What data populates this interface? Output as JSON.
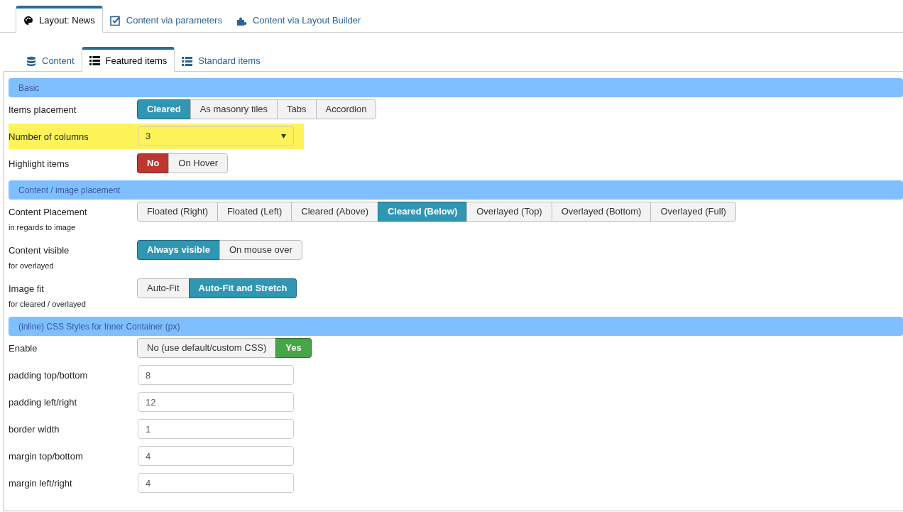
{
  "top_tabs": [
    {
      "label": "Layout: News",
      "selected": true
    },
    {
      "label": "Content via parameters",
      "selected": false
    },
    {
      "label": "Content via Layout Builder",
      "selected": false
    }
  ],
  "sub_tabs": [
    {
      "label": "Content",
      "selected": false
    },
    {
      "label": "Featured items",
      "selected": true
    },
    {
      "label": "Standard items",
      "selected": false
    }
  ],
  "sections": [
    {
      "title": "Basic",
      "rows": [
        {
          "kind": "buttons",
          "label": "Items placement",
          "highlighted": false,
          "color": "#2f96b4",
          "options": [
            {
              "label": "Cleared",
              "selected": true
            },
            {
              "label": "As masonry tiles",
              "selected": false
            },
            {
              "label": "Tabs",
              "selected": false
            },
            {
              "label": "Accordion",
              "selected": false
            }
          ]
        },
        {
          "kind": "select",
          "label": "Number of columns",
          "highlighted": true,
          "value": "3"
        },
        {
          "kind": "buttons",
          "label": "Highlight items",
          "highlighted": false,
          "color": "#bd362f",
          "options": [
            {
              "label": "No",
              "selected": true
            },
            {
              "label": "On Hover",
              "selected": false
            }
          ]
        }
      ]
    },
    {
      "title": "Content / image placement",
      "rows": [
        {
          "kind": "buttons",
          "label": "Content Placement",
          "hint": "in regards to image",
          "highlighted": false,
          "color": "#2f96b4",
          "options": [
            {
              "label": "Floated (Right)",
              "selected": false
            },
            {
              "label": "Floated (Left)",
              "selected": false
            },
            {
              "label": "Cleared (Above)",
              "selected": false
            },
            {
              "label": "Cleared (Below)",
              "selected": true
            },
            {
              "label": "Overlayed (Top)",
              "selected": false
            },
            {
              "label": "Overlayed (Bottom)",
              "selected": false
            },
            {
              "label": "Overlayed (Full)",
              "selected": false
            }
          ]
        },
        {
          "kind": "buttons",
          "label": "Content visible",
          "hint": "for overlayed",
          "highlighted": false,
          "color": "#2f96b4",
          "options": [
            {
              "label": "Always visible",
              "selected": true
            },
            {
              "label": "On mouse over",
              "selected": false
            }
          ]
        },
        {
          "kind": "buttons",
          "label": "Image fit",
          "hint": "for cleared / overlayed",
          "highlighted": false,
          "color": "#2f96b4",
          "options": [
            {
              "label": "Auto-Fit",
              "selected": false
            },
            {
              "label": "Auto-Fit and Stretch",
              "selected": true
            }
          ]
        }
      ]
    },
    {
      "title": "(inline) CSS Styles for Inner Container (px)",
      "rows": [
        {
          "kind": "buttons",
          "label": "Enable",
          "highlighted": false,
          "color": "#46a546",
          "options": [
            {
              "label": "No (use default/custom CSS)",
              "selected": false
            },
            {
              "label": "Yes",
              "selected": true
            }
          ]
        },
        {
          "kind": "text",
          "label": "padding top/bottom",
          "highlighted": false,
          "value": "8"
        },
        {
          "kind": "text",
          "label": "padding left/right",
          "highlighted": false,
          "value": "12"
        },
        {
          "kind": "text",
          "label": "border width",
          "highlighted": false,
          "value": "1"
        },
        {
          "kind": "text",
          "label": "margin top/bottom",
          "highlighted": false,
          "value": "4"
        },
        {
          "kind": "text",
          "label": "margin left/right",
          "highlighted": false,
          "value": "4"
        }
      ]
    }
  ]
}
